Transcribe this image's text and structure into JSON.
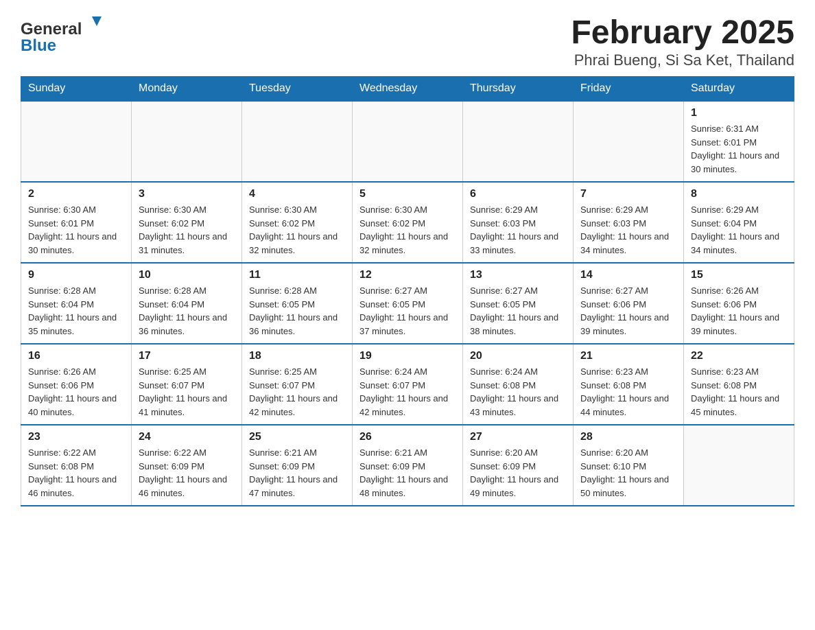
{
  "header": {
    "logo": {
      "general": "General",
      "blue": "Blue"
    },
    "title": "February 2025",
    "subtitle": "Phrai Bueng, Si Sa Ket, Thailand"
  },
  "calendar": {
    "days_of_week": [
      "Sunday",
      "Monday",
      "Tuesday",
      "Wednesday",
      "Thursday",
      "Friday",
      "Saturday"
    ],
    "weeks": [
      [
        {
          "day": "",
          "info": ""
        },
        {
          "day": "",
          "info": ""
        },
        {
          "day": "",
          "info": ""
        },
        {
          "day": "",
          "info": ""
        },
        {
          "day": "",
          "info": ""
        },
        {
          "day": "",
          "info": ""
        },
        {
          "day": "1",
          "info": "Sunrise: 6:31 AM\nSunset: 6:01 PM\nDaylight: 11 hours and 30 minutes."
        }
      ],
      [
        {
          "day": "2",
          "info": "Sunrise: 6:30 AM\nSunset: 6:01 PM\nDaylight: 11 hours and 30 minutes."
        },
        {
          "day": "3",
          "info": "Sunrise: 6:30 AM\nSunset: 6:02 PM\nDaylight: 11 hours and 31 minutes."
        },
        {
          "day": "4",
          "info": "Sunrise: 6:30 AM\nSunset: 6:02 PM\nDaylight: 11 hours and 32 minutes."
        },
        {
          "day": "5",
          "info": "Sunrise: 6:30 AM\nSunset: 6:02 PM\nDaylight: 11 hours and 32 minutes."
        },
        {
          "day": "6",
          "info": "Sunrise: 6:29 AM\nSunset: 6:03 PM\nDaylight: 11 hours and 33 minutes."
        },
        {
          "day": "7",
          "info": "Sunrise: 6:29 AM\nSunset: 6:03 PM\nDaylight: 11 hours and 34 minutes."
        },
        {
          "day": "8",
          "info": "Sunrise: 6:29 AM\nSunset: 6:04 PM\nDaylight: 11 hours and 34 minutes."
        }
      ],
      [
        {
          "day": "9",
          "info": "Sunrise: 6:28 AM\nSunset: 6:04 PM\nDaylight: 11 hours and 35 minutes."
        },
        {
          "day": "10",
          "info": "Sunrise: 6:28 AM\nSunset: 6:04 PM\nDaylight: 11 hours and 36 minutes."
        },
        {
          "day": "11",
          "info": "Sunrise: 6:28 AM\nSunset: 6:05 PM\nDaylight: 11 hours and 36 minutes."
        },
        {
          "day": "12",
          "info": "Sunrise: 6:27 AM\nSunset: 6:05 PM\nDaylight: 11 hours and 37 minutes."
        },
        {
          "day": "13",
          "info": "Sunrise: 6:27 AM\nSunset: 6:05 PM\nDaylight: 11 hours and 38 minutes."
        },
        {
          "day": "14",
          "info": "Sunrise: 6:27 AM\nSunset: 6:06 PM\nDaylight: 11 hours and 39 minutes."
        },
        {
          "day": "15",
          "info": "Sunrise: 6:26 AM\nSunset: 6:06 PM\nDaylight: 11 hours and 39 minutes."
        }
      ],
      [
        {
          "day": "16",
          "info": "Sunrise: 6:26 AM\nSunset: 6:06 PM\nDaylight: 11 hours and 40 minutes."
        },
        {
          "day": "17",
          "info": "Sunrise: 6:25 AM\nSunset: 6:07 PM\nDaylight: 11 hours and 41 minutes."
        },
        {
          "day": "18",
          "info": "Sunrise: 6:25 AM\nSunset: 6:07 PM\nDaylight: 11 hours and 42 minutes."
        },
        {
          "day": "19",
          "info": "Sunrise: 6:24 AM\nSunset: 6:07 PM\nDaylight: 11 hours and 42 minutes."
        },
        {
          "day": "20",
          "info": "Sunrise: 6:24 AM\nSunset: 6:08 PM\nDaylight: 11 hours and 43 minutes."
        },
        {
          "day": "21",
          "info": "Sunrise: 6:23 AM\nSunset: 6:08 PM\nDaylight: 11 hours and 44 minutes."
        },
        {
          "day": "22",
          "info": "Sunrise: 6:23 AM\nSunset: 6:08 PM\nDaylight: 11 hours and 45 minutes."
        }
      ],
      [
        {
          "day": "23",
          "info": "Sunrise: 6:22 AM\nSunset: 6:08 PM\nDaylight: 11 hours and 46 minutes."
        },
        {
          "day": "24",
          "info": "Sunrise: 6:22 AM\nSunset: 6:09 PM\nDaylight: 11 hours and 46 minutes."
        },
        {
          "day": "25",
          "info": "Sunrise: 6:21 AM\nSunset: 6:09 PM\nDaylight: 11 hours and 47 minutes."
        },
        {
          "day": "26",
          "info": "Sunrise: 6:21 AM\nSunset: 6:09 PM\nDaylight: 11 hours and 48 minutes."
        },
        {
          "day": "27",
          "info": "Sunrise: 6:20 AM\nSunset: 6:09 PM\nDaylight: 11 hours and 49 minutes."
        },
        {
          "day": "28",
          "info": "Sunrise: 6:20 AM\nSunset: 6:10 PM\nDaylight: 11 hours and 50 minutes."
        },
        {
          "day": "",
          "info": ""
        }
      ]
    ]
  }
}
